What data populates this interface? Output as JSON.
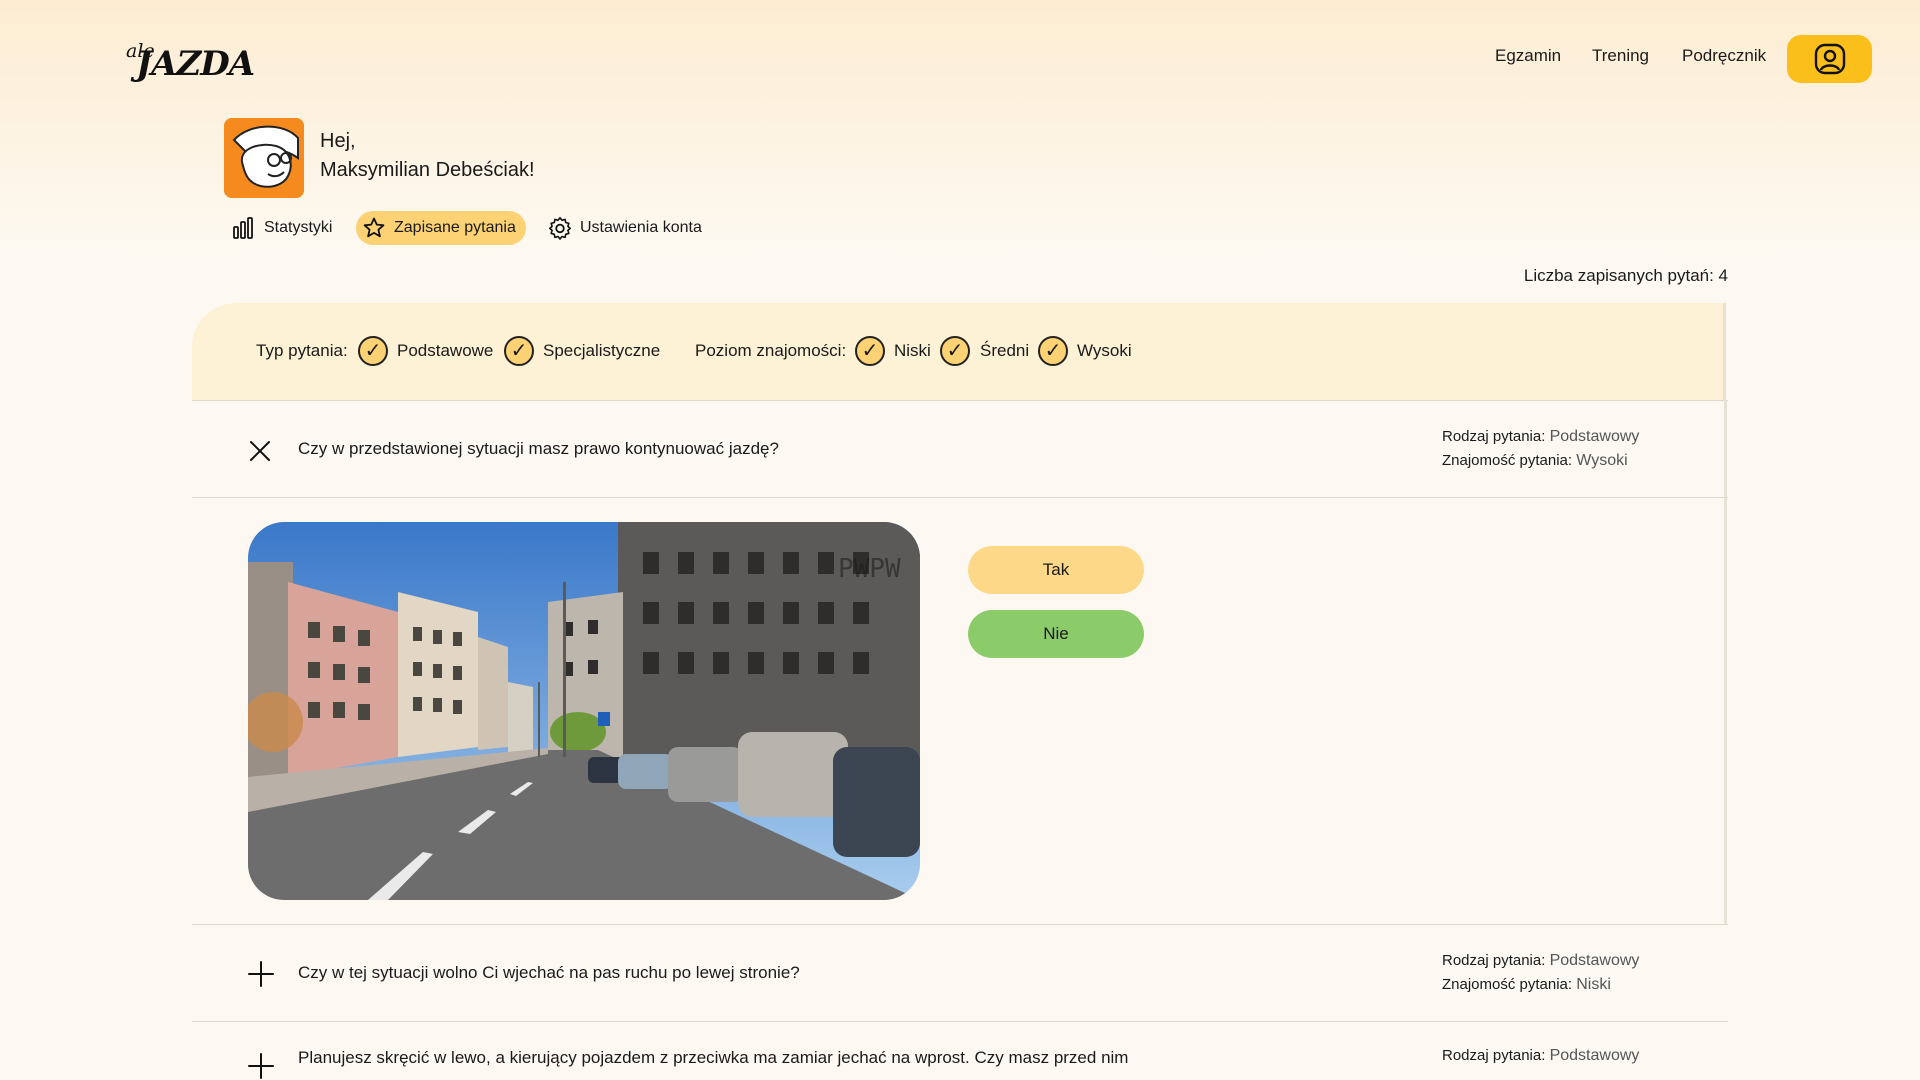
{
  "header": {
    "logo_small": "ale",
    "logo_big": "JAZDA",
    "nav": [
      "Egzamin",
      "Trening",
      "Podręcznik"
    ],
    "account_icon": "user-icon",
    "accent": "#fbbf1c"
  },
  "profile": {
    "greeting": "Hej,",
    "name": "Maksymilian Debeściak!",
    "tabs": [
      {
        "label": "Statystyki",
        "icon": "bar-chart-icon",
        "active": false
      },
      {
        "label": "Zapisane pytania",
        "icon": "star-icon",
        "active": true
      },
      {
        "label": "Ustawienia konta",
        "icon": "gear-icon",
        "active": false
      }
    ]
  },
  "saved_count": "Liczba zapisanych pytań: 4",
  "filters": {
    "type_label": "Typ pytania:",
    "types": [
      "Podstawowe",
      "Specjalistyczne"
    ],
    "level_label": "Poziom znajomości:",
    "levels": [
      "Niski",
      "Średni",
      "Wysoki"
    ],
    "check_glyph": "✓"
  },
  "meta_labels": {
    "type": "Rodzaj pytania:",
    "familiarity": "Znajomość pytania:"
  },
  "questions": [
    {
      "text": "Czy w przedstawionej sytuacji masz prawo kontynuować jazdę?",
      "type": "Podstawowy",
      "familiarity": "Wysoki",
      "expanded": true,
      "toggle_icon": "close-icon",
      "answers": [
        "Tak",
        "Nie"
      ],
      "media_watermark": "PWPW"
    },
    {
      "text": "Czy w tej sytuacji wolno Ci wjechać na pas ruchu po lewej stronie?",
      "type": "Podstawowy",
      "familiarity": "Niski",
      "expanded": false,
      "toggle_icon": "plus-icon"
    },
    {
      "text": "Planujesz skręcić w lewo, a kierujący pojazdem z przeciwka ma zamiar jechać na wprost. Czy masz przed nim",
      "type": "Podstawowy",
      "expanded": false,
      "toggle_icon": "plus-icon"
    }
  ]
}
